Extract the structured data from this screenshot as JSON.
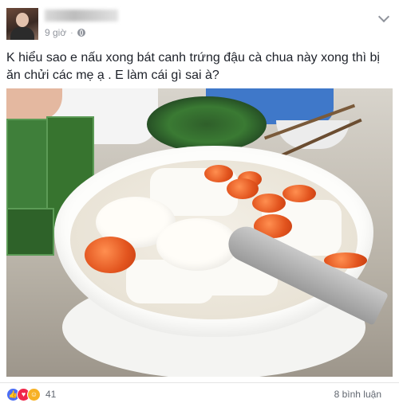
{
  "header": {
    "timestamp": "9 giờ",
    "separator": "·"
  },
  "post": {
    "text_part1": "K hiểu sao e nấu xong bát canh trứng đậu cà chua này xong thì bị ăn chửi các mẹ ạ . E làm cái gì sai à?"
  },
  "footer": {
    "reaction_count": "41",
    "comments": "8 bình luận"
  },
  "icons": [
    "globe-icon",
    "chevron-down-icon",
    "like-icon",
    "love-icon",
    "haha-icon"
  ]
}
